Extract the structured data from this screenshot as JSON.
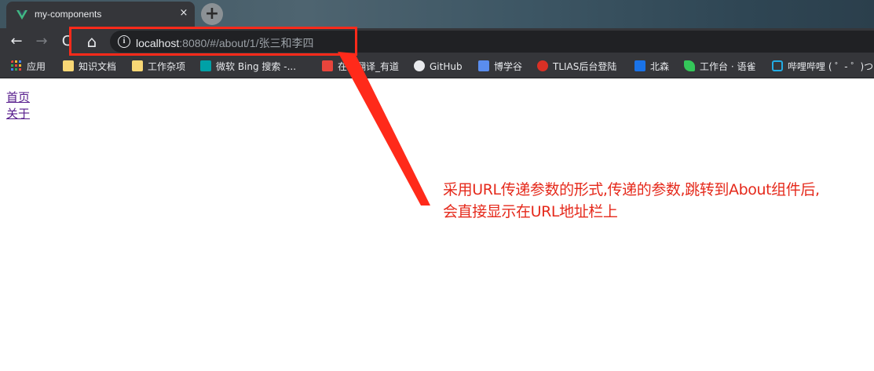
{
  "tab": {
    "title": "my-components",
    "close_glyph": "×",
    "favicon": "vue-logo-icon",
    "new_tab_glyph": "+"
  },
  "toolbar": {
    "back_glyph": "←",
    "forward_glyph": "→",
    "reload_glyph": "C",
    "home_glyph": "⌂",
    "info_glyph": "i",
    "url_host": "localhost",
    "url_rest": ":8080/#/about/1/张三和李四"
  },
  "bookmarks": [
    {
      "label": "应用",
      "icon": "apps-grid-icon",
      "color": "#e8453c"
    },
    {
      "label": "知识文档",
      "icon": "folder-icon",
      "color": "#f8d775"
    },
    {
      "label": "工作杂项",
      "icon": "folder-icon",
      "color": "#f8d775"
    },
    {
      "label": "微软 Bing 搜索 -...",
      "icon": "bing-icon",
      "color": "#00a1a7"
    },
    {
      "label": "在线翻译_有道",
      "icon": "youdao-icon",
      "color": "#e8453c"
    },
    {
      "label": "GitHub",
      "icon": "github-icon",
      "color": "#e8eaed"
    },
    {
      "label": "博学谷",
      "icon": "boxuegu-icon",
      "color": "#5a8dee"
    },
    {
      "label": "TLIAS后台登陆",
      "icon": "tlias-icon",
      "color": "#d93025"
    },
    {
      "label": "北森",
      "icon": "beisen-icon",
      "color": "#1a73e8"
    },
    {
      "label": "工作台 · 语雀",
      "icon": "yuque-icon",
      "color": "#34c759"
    },
    {
      "label": "哔哩哔哩 ( ゜- ゜)つ...",
      "icon": "bilibili-icon",
      "color": "#23ade5"
    }
  ],
  "page": {
    "links": [
      "首页",
      "关于"
    ]
  },
  "annotation": {
    "line1": "采用URL传递参数的形式,传递的参数,跳转到About组件后,",
    "line2": "会直接显示在URL地址栏上",
    "color": "#e5291b"
  }
}
